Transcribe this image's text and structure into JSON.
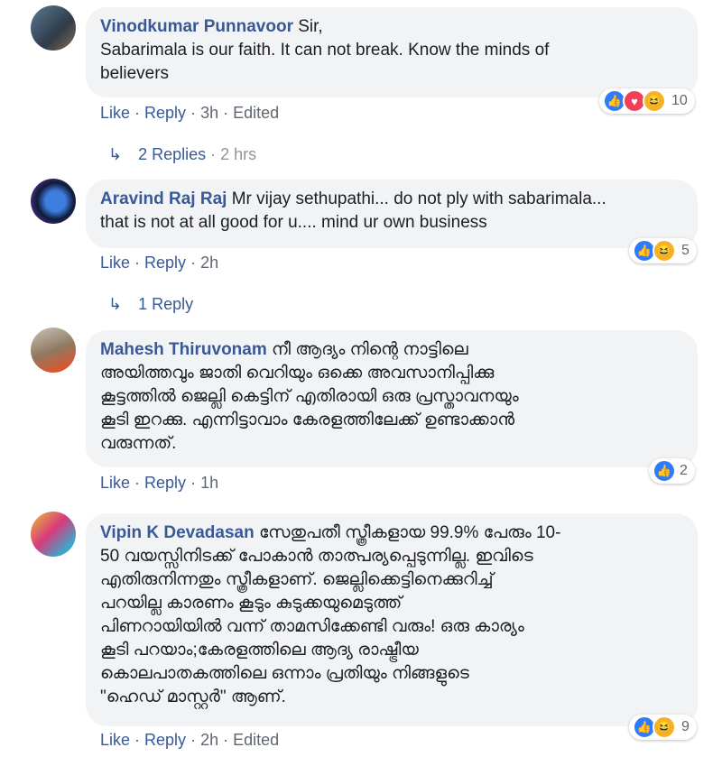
{
  "comments": [
    {
      "author": "Vinodkumar Punnavoor",
      "text": "Sir,\nSabarimala is our faith. It can not break. Know the minds of believers",
      "line1": "Sir,",
      "line2": "Sabarimala is our faith. It can not break. Know the minds of",
      "line3": "believers",
      "actions": {
        "like": "Like",
        "reply": "Reply",
        "time": "3h",
        "edited": "Edited"
      },
      "reaction_icons": [
        "like-icon",
        "love-icon",
        "haha-icon"
      ],
      "reaction_count": "10",
      "replies_label": "2 Replies",
      "replies_time": "2 hrs"
    },
    {
      "author": "Aravind Raj Raj",
      "line1": "Mr vijay sethupathi... do not ply with sabarimala...",
      "line2": "that is not at all good for u.... mind ur own business",
      "actions": {
        "like": "Like",
        "reply": "Reply",
        "time": "2h"
      },
      "reaction_icons": [
        "like-icon",
        "haha-icon"
      ],
      "reaction_count": "5",
      "replies_label": "1 Reply"
    },
    {
      "author": "Mahesh Thiruvonam",
      "line1": "നീ ആദ്യം നിന്റെ നാട്ടിലെ",
      "line2": "അയിത്തവും ജാതി വെറിയും ഒക്കെ അവസാനിപ്പിക്കു",
      "line3": "കൂട്ടത്തിൽ ജെല്ലി കെട്ടിന് എതിരായി ഒരു പ്രസ്താവനയും",
      "line4": "കൂടി ഇറക്കു. എന്നിട്ടാവാം കേരളത്തിലേക്ക് ഉണ്ടാക്കാൻ",
      "line5": "വരുന്നത്.",
      "actions": {
        "like": "Like",
        "reply": "Reply",
        "time": "1h"
      },
      "reaction_icons": [
        "like-icon"
      ],
      "reaction_count": "2"
    },
    {
      "author": "Vipin K Devadasan",
      "line1": "സേതുപതീ സ്ത്രീകളായ 99.9% പേരും 10-",
      "line2": "50 വയസ്സിനിടക്ക് പോകാൻ താത്പര്യപ്പെടുന്നില്ല. ഇവിടെ",
      "line3": "എതിരുനിന്നതും സ്ത്രീകളാണ്. ജെല്ലിക്കെട്ടിനെക്കുറിച്ച്",
      "line4": "പറയില്ല കാരണം കൂടും കുടുക്കയുമെടുത്ത്",
      "line5": "പിണറായിയിൽ വന്ന് താമസിക്കേണ്ടി വരും! ഒരു കാര്യം",
      "line6": "കൂടി പറയാം;കേരളത്തിലെ ആദ്യ രാഷ്ട്രീയ",
      "line7": "കൊലപാതകത്തിലെ ഒന്നാം പ്രതിയും നിങ്ങളുടെ",
      "line8": "\"ഹെഡ് മാസ്റ്റർ\" ആണ്.",
      "actions": {
        "like": "Like",
        "reply": "Reply",
        "time": "2h",
        "edited": "Edited"
      },
      "reaction_icons": [
        "like-icon",
        "haha-icon"
      ],
      "reaction_count": "9"
    }
  ],
  "colors": {
    "author": "#385898",
    "bubble": "#f2f3f5",
    "meta": "#606770",
    "like": "#2e7bff",
    "love": "#f33e58",
    "haha": "#f7b125"
  }
}
